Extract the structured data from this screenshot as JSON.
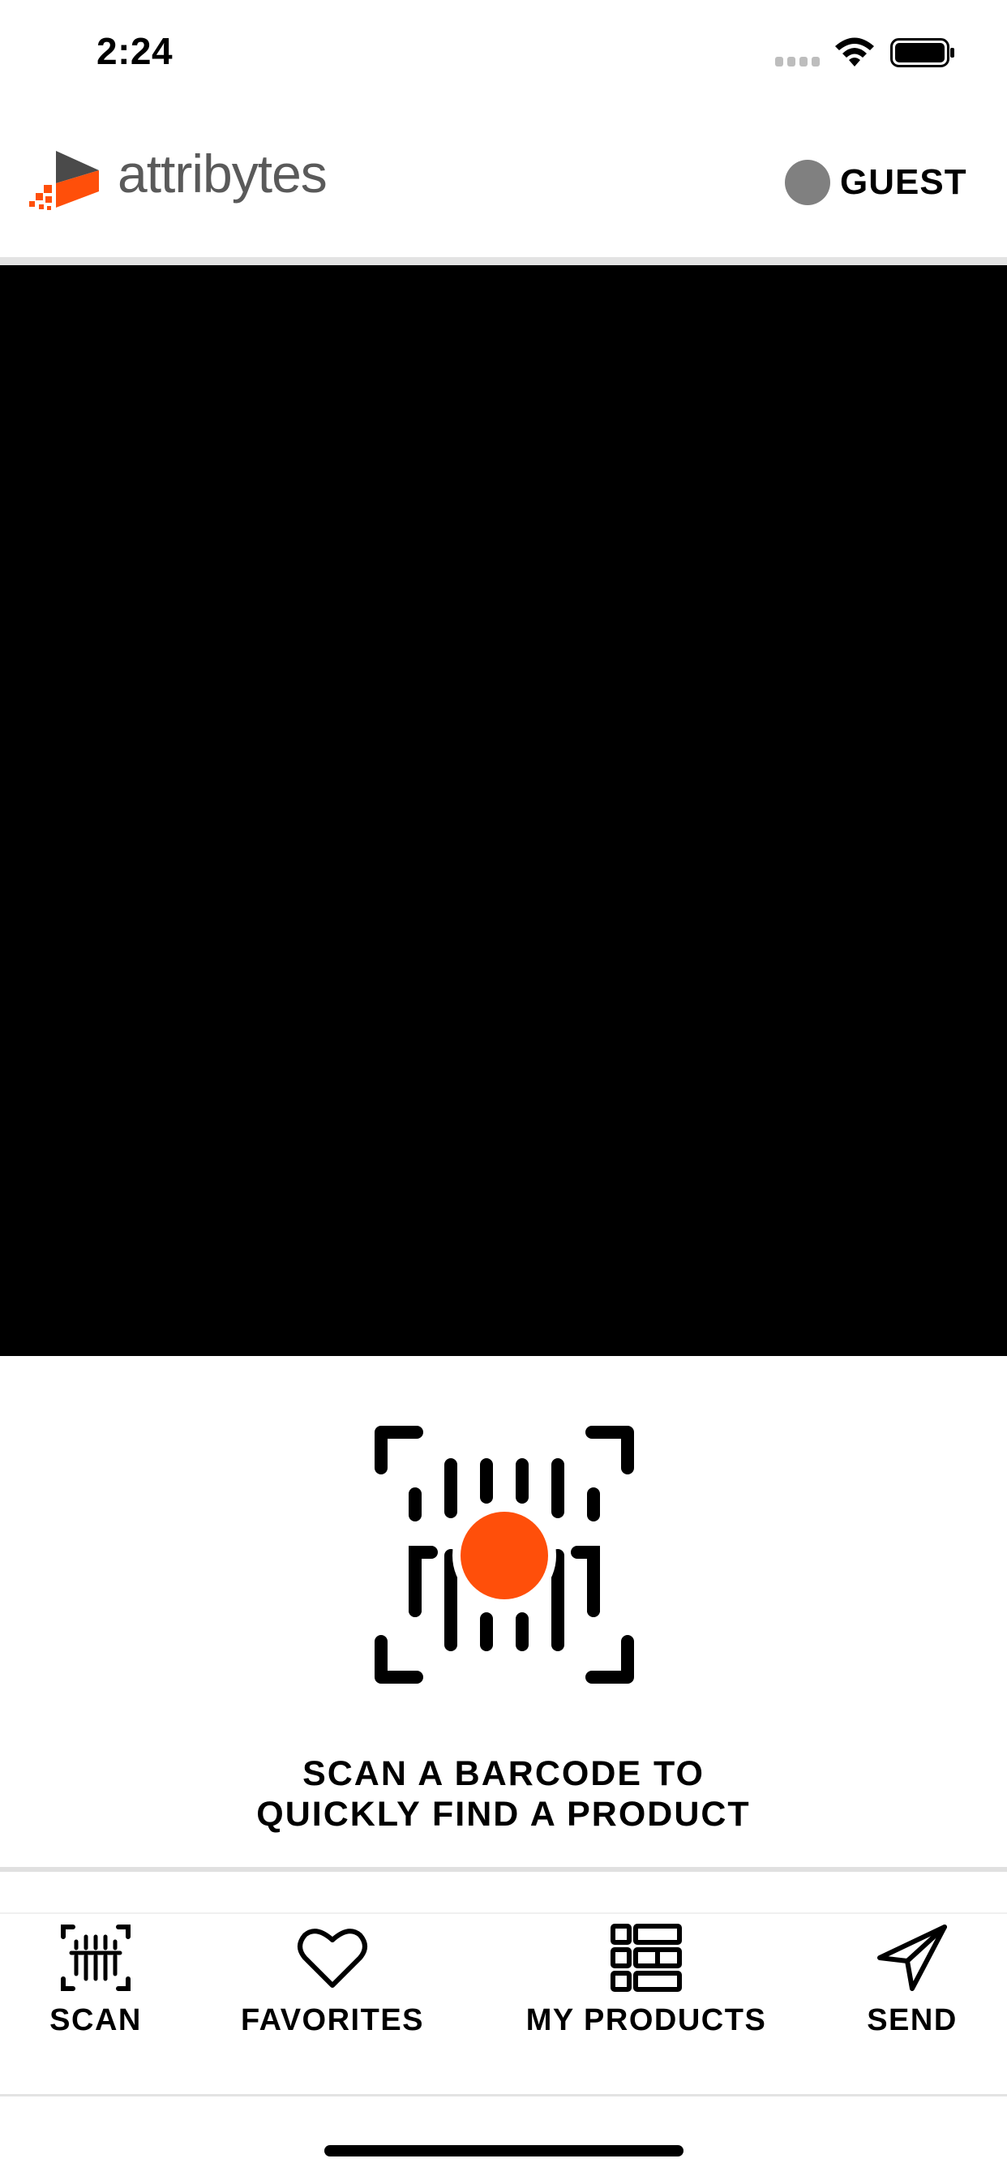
{
  "status_bar": {
    "time": "2:24",
    "icons": [
      "cellular-signal-icon",
      "wifi-icon",
      "battery-icon"
    ]
  },
  "header": {
    "brand": "attribytes",
    "user_label": "GUEST",
    "logo_icon": "attribytes-logo-icon",
    "avatar_icon": "guest-avatar-icon"
  },
  "camera": {
    "state": "black"
  },
  "scan_prompt": {
    "icon": "barcode-scan-icon",
    "line1": "SCAN A BARCODE TO",
    "line2": "QUICKLY FIND A PRODUCT"
  },
  "tabs": [
    {
      "label": "SCAN",
      "icon": "scan-barcode-icon"
    },
    {
      "label": "FAVORITES",
      "icon": "heart-icon"
    },
    {
      "label": "MY PRODUCTS",
      "icon": "grid-icon"
    },
    {
      "label": "SEND",
      "icon": "paper-plane-icon"
    }
  ],
  "colors": {
    "accent": "#ff4f0a",
    "avatar": "#808080",
    "brand_text": "#5a5a5a",
    "divider": "#e3e3e3"
  }
}
